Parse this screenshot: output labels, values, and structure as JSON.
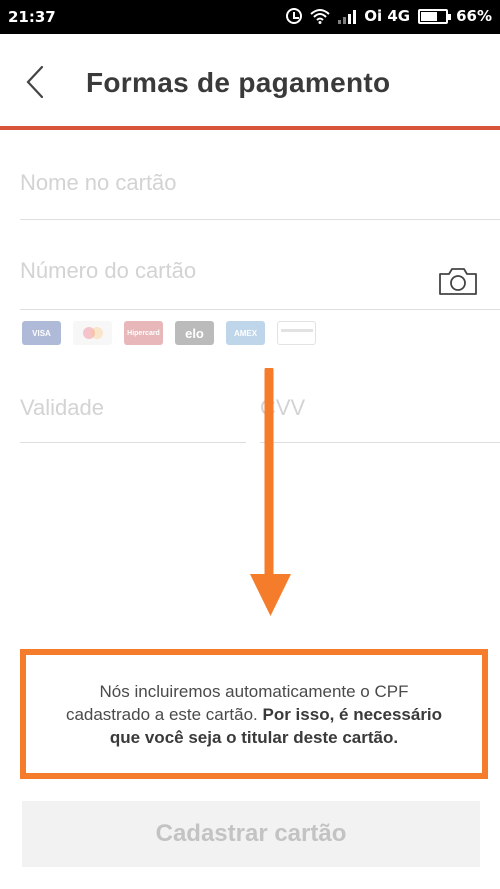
{
  "status_bar": {
    "time": "21:37",
    "carrier": "Oi 4G",
    "battery": "66%",
    "battery_level": 0.66,
    "icons": [
      "alarm-icon",
      "wifi-icon",
      "signal-icon",
      "battery-icon"
    ]
  },
  "header": {
    "title": "Formas de pagamento",
    "back_icon": "chevron-left-icon",
    "accent_color": "#d8553a"
  },
  "form": {
    "name_placeholder": "Nome no cartão",
    "number_placeholder": "Número do cartão",
    "camera_icon": "camera-icon",
    "card_brands": [
      "VISA",
      "Mastercard",
      "Hipercard",
      "elo",
      "AMEX",
      "generic-card"
    ],
    "validity_placeholder": "Validade",
    "cvv_placeholder": "CVV"
  },
  "annotation": {
    "arrow_color": "#f47c2a",
    "box_color": "#f47c2a"
  },
  "info": {
    "line1": "Nós incluiremos automaticamente o CPF",
    "line2_normal": "cadastrado a este cartão. ",
    "line2_bold": "Por isso, é necessário",
    "line3_bold": "que você seja o titular deste cartão."
  },
  "button": {
    "label": "Cadastrar cartão"
  }
}
